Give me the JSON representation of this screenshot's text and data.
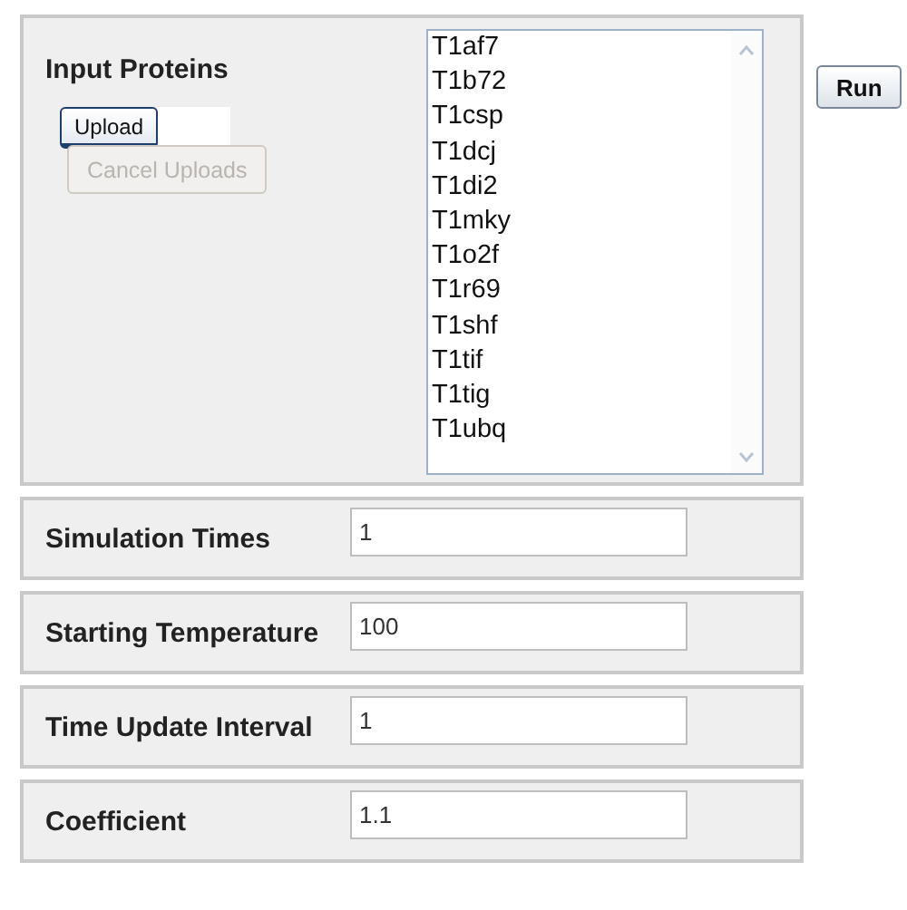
{
  "input_proteins": {
    "label": "Input Proteins",
    "upload_button": "Upload",
    "cancel_button": {
      "label": "Cancel Uploads",
      "disabled": true
    },
    "proteins": [
      "T1af7",
      "T1b72",
      "T1csp",
      "T1dcj",
      "T1di2",
      "T1mky",
      "T1o2f",
      "T1r69",
      "T1shf",
      "T1tif",
      "T1tig",
      "T1ubq"
    ]
  },
  "run_button": "Run",
  "parameters": [
    {
      "label": "Simulation Times",
      "value": "1"
    },
    {
      "label": "Starting Temperature",
      "value": "100"
    },
    {
      "label": "Time Update Interval",
      "value": "1"
    },
    {
      "label": "Coefficient",
      "value": "1.1"
    }
  ]
}
